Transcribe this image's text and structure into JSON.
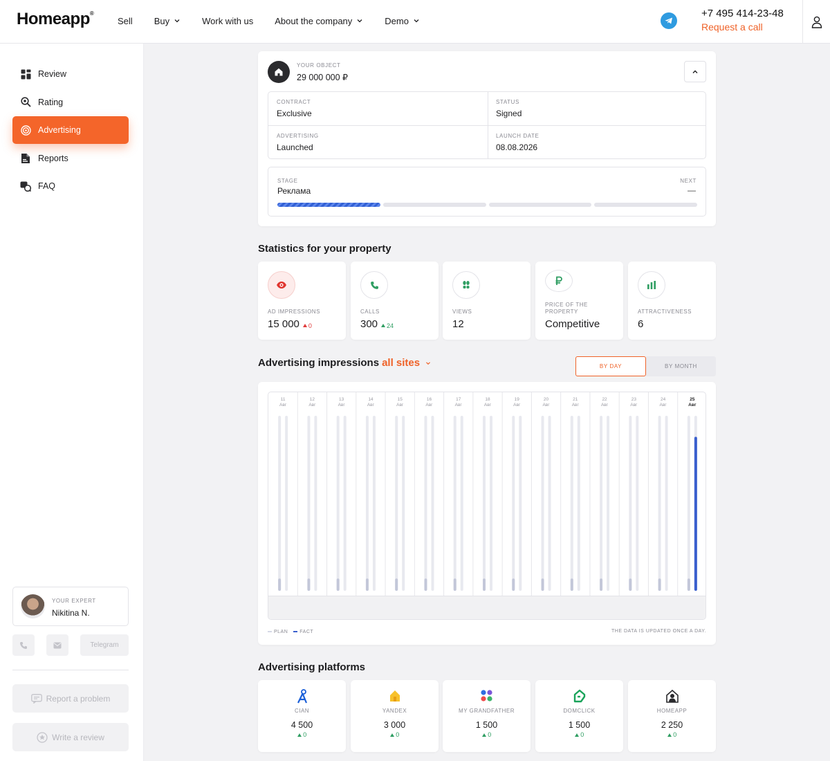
{
  "header": {
    "logo": "Homeapp",
    "logo_mark": "®",
    "nav": [
      {
        "label": "Sell",
        "dropdown": false
      },
      {
        "label": "Buy",
        "dropdown": true
      },
      {
        "label": "Work with us",
        "dropdown": false
      },
      {
        "label": "About the company",
        "dropdown": true
      },
      {
        "label": "Demo",
        "dropdown": true
      }
    ],
    "phone": "+7 495 414-23-48",
    "request_call": "Request a call"
  },
  "sidebar": {
    "items": [
      {
        "label": "Review",
        "icon": "grid-icon",
        "active": false
      },
      {
        "label": "Rating",
        "icon": "search-icon",
        "active": false
      },
      {
        "label": "Advertising",
        "icon": "target-icon",
        "active": true
      },
      {
        "label": "Reports",
        "icon": "document-icon",
        "active": false
      },
      {
        "label": "FAQ",
        "icon": "faq-icon",
        "active": false
      }
    ],
    "expert": {
      "label": "YOUR EXPERT",
      "name": "Nikitina N."
    },
    "contacts": {
      "telegram": "Telegram"
    },
    "report_problem": "Report a problem",
    "write_review": "Write a review"
  },
  "object": {
    "label": "YOUR OBJECT",
    "price": "29 000 000 ₽",
    "fields": [
      {
        "label": "CONTRACT",
        "value": "Exclusive"
      },
      {
        "label": "STATUS",
        "value": "Signed"
      },
      {
        "label": "ADVERTISING",
        "value": "Launched"
      },
      {
        "label": "LAUNCH DATE",
        "value": "08.08.2026"
      }
    ],
    "stage": {
      "label": "STAGE",
      "value": "Реклама",
      "next_label": "NEXT",
      "next_value": "—",
      "steps_total": 4,
      "steps_done": 1
    }
  },
  "statistics": {
    "title": "Statistics for your property",
    "cards": [
      {
        "label": "AD IMPRESSIONS",
        "value": "15 000",
        "delta": "0",
        "delta_dir": "red",
        "icon": "eye-icon",
        "icon_color": "#e0362f",
        "icon_bg": "#fdeceb"
      },
      {
        "label": "CALLS",
        "value": "300",
        "delta": "24",
        "delta_dir": "green",
        "icon": "phone-icon",
        "icon_color": "#2f9e62",
        "icon_bg": "#ffffff"
      },
      {
        "label": "VIEWS",
        "value": "12",
        "delta": "",
        "delta_dir": "",
        "icon": "footsteps-icon",
        "icon_color": "#2f9e62",
        "icon_bg": "#ffffff"
      },
      {
        "label": "PRICE OF THE PROPERTY",
        "value": "Competitive",
        "delta": "",
        "delta_dir": "",
        "icon": "ruble-icon",
        "icon_color": "#2f9e62",
        "icon_bg": "#ffffff"
      },
      {
        "label": "ATTRACTIVENESS",
        "value": "6",
        "delta": "",
        "delta_dir": "",
        "icon": "bar-chart-icon",
        "icon_color": "#2f9e62",
        "icon_bg": "#ffffff"
      }
    ]
  },
  "impressions": {
    "title": "Advertising impressions",
    "filter": "all sites",
    "by_day": "BY DAY",
    "by_month": "BY MONTH",
    "legend_plan": "PLAN",
    "legend_fact": "FACT",
    "updated_note": "THE DATA IS UPDATED ONCE A DAY."
  },
  "chart_data": {
    "type": "bar",
    "categories": [
      "11 Авг",
      "12 Авг",
      "13 Авг",
      "14 Авг",
      "15 Авг",
      "16 Авг",
      "17 Авг",
      "18 Авг",
      "19 Авг",
      "20 Авг",
      "21 Авг",
      "22 Авг",
      "23 Авг",
      "24 Авг",
      "25 Авг"
    ],
    "series": [
      {
        "name": "PLAN",
        "color": "#d5d8e6",
        "values": [
          0.07,
          0.07,
          0.07,
          0.07,
          0.07,
          0.07,
          0.07,
          0.07,
          0.07,
          0.07,
          0.07,
          0.07,
          0.07,
          0.07,
          0.07
        ]
      },
      {
        "name": "FACT",
        "color": "#3a5fcd",
        "values": [
          0,
          0,
          0,
          0,
          0,
          0,
          0,
          0,
          0,
          0,
          0,
          0,
          0,
          0,
          0.88
        ]
      }
    ],
    "ylim": [
      0,
      1
    ],
    "highlight_index": 14
  },
  "platforms": {
    "title": "Advertising platforms",
    "items": [
      {
        "name": "CIAN",
        "value": "4 500",
        "delta": "0",
        "icon": "cian-icon"
      },
      {
        "name": "YANDEX",
        "value": "3 000",
        "delta": "0",
        "icon": "yandex-icon"
      },
      {
        "name": "MY GRANDFATHER",
        "value": "1 500",
        "delta": "0",
        "icon": "grandfather-icon"
      },
      {
        "name": "DOMCLICK",
        "value": "1 500",
        "delta": "0",
        "icon": "domclick-icon"
      },
      {
        "name": "HOMEAPP",
        "value": "2 250",
        "delta": "0",
        "icon": "homeapp-icon"
      }
    ]
  }
}
